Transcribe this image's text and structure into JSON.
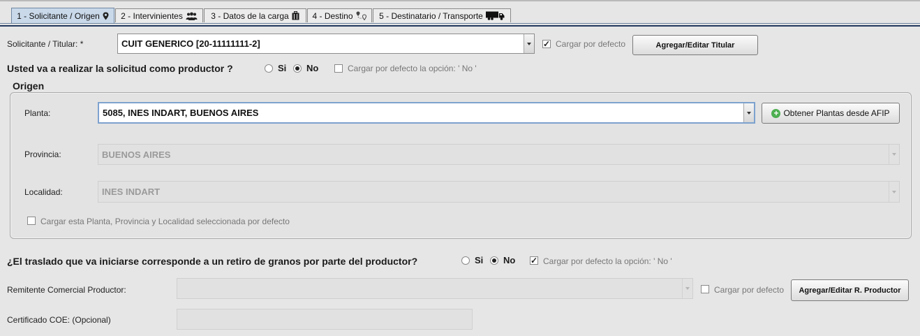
{
  "tabs": [
    {
      "label": "1 - Solicitante / Origen",
      "icon": "location-pin-icon"
    },
    {
      "label": "2 - Intervinientes",
      "icon": "people-icon"
    },
    {
      "label": "3 - Datos de la carga",
      "icon": "cargo-bag-icon"
    },
    {
      "label": "4 - Destino",
      "icon": "route-pins-icon"
    },
    {
      "label": "5 - Destinatario / Transporte",
      "icon": "truck-icon"
    }
  ],
  "solicitante": {
    "label": "Solicitante / Titular: *",
    "value": "CUIT GENERICO [20-11111111-2]",
    "default_label": "Cargar por defecto",
    "default_checked": true,
    "button": "Agregar/Editar Titular"
  },
  "productor_question": {
    "text": "Usted va a realizar la solicitud como productor ?",
    "yes": "Si",
    "no": "No",
    "selected": "No",
    "default_label": "Cargar por defecto la opción: ' No '",
    "default_checked": false
  },
  "origen": {
    "title": "Origen",
    "planta_label": "Planta:",
    "planta_value": "5085, INES INDART, BUENOS AIRES",
    "obtener_button": "Obtener Plantas desde AFIP",
    "provincia_label": "Provincia:",
    "provincia_value": "BUENOS AIRES",
    "localidad_label": "Localidad:",
    "localidad_value": "INES INDART",
    "default_label": "Cargar esta Planta, Provincia y Localidad seleccionada por defecto",
    "default_checked": false
  },
  "retiro_question": {
    "text": "¿El traslado que va iniciarse corresponde a un retiro de granos por parte del productor?",
    "yes": "Si",
    "no": "No",
    "selected": "No",
    "default_label": "Cargar por defecto la opción: ' No '",
    "default_checked": true
  },
  "remitente": {
    "label": "Remitente Comercial Productor:",
    "value": "",
    "default_label": "Cargar por defecto",
    "default_checked": false,
    "button": "Agregar/Editar R. Productor"
  },
  "coe": {
    "label": "Certificado COE: (Opcional)",
    "value": ""
  }
}
